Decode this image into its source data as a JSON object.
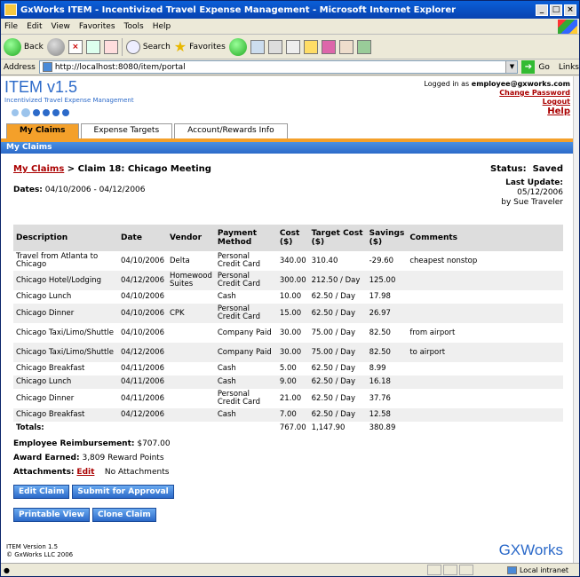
{
  "window": {
    "title": "GxWorks ITEM - Incentivized Travel Expense Management - Microsoft Internet Explorer"
  },
  "menu": [
    "File",
    "Edit",
    "View",
    "Favorites",
    "Tools",
    "Help"
  ],
  "toolbar": {
    "back": "Back",
    "search": "Search",
    "favorites": "Favorites"
  },
  "address": {
    "label": "Address",
    "url": "http://localhost:8080/item/portal",
    "go": "Go",
    "links": "Links"
  },
  "header": {
    "app_title": "ITEM v1.5",
    "app_subtitle": "Incentivized Travel Expense Management",
    "logged_in_prefix": "Logged in as",
    "user_email": "employee@gxworks.com",
    "change_password": "Change Password",
    "logout": "Logout",
    "help": "Help"
  },
  "tabs": [
    {
      "label": "My Claims",
      "active": true
    },
    {
      "label": "Expense Targets",
      "active": false
    },
    {
      "label": "Account/Rewards Info",
      "active": false
    }
  ],
  "section_title": "My Claims",
  "claim": {
    "breadcrumb_link": "My Claims",
    "breadcrumb_rest": "> Claim 18: Chicago Meeting",
    "status_label": "Status:",
    "status_value": "Saved",
    "dates_label": "Dates:",
    "dates_value": "04/10/2006 - 04/12/2006",
    "last_update_label": "Last Update:",
    "last_update_date": "05/12/2006",
    "last_update_by": "by Sue Traveler"
  },
  "table": {
    "headers": [
      "Description",
      "Date",
      "Vendor",
      "Payment Method",
      "Cost ($)",
      "Target Cost ($)",
      "Savings ($)",
      "Comments"
    ],
    "rows": [
      [
        "Travel from Atlanta to Chicago",
        "04/10/2006",
        "Delta",
        "Personal Credit Card",
        "340.00",
        "310.40",
        "-29.60",
        "cheapest nonstop"
      ],
      [
        "Chicago Hotel/Lodging",
        "04/12/2006",
        "Homewood Suites",
        "Personal Credit Card",
        "300.00",
        "212.50 / Day",
        "125.00",
        ""
      ],
      [
        "Chicago Lunch",
        "04/10/2006",
        "",
        "Cash",
        "10.00",
        "62.50 / Day",
        "17.98",
        ""
      ],
      [
        "Chicago Dinner",
        "04/10/2006",
        "CPK",
        "Personal Credit Card",
        "15.00",
        "62.50 / Day",
        "26.97",
        ""
      ],
      [
        "Chicago Taxi/Limo/Shuttle",
        "04/10/2006",
        "",
        "Company Paid",
        "30.00",
        "75.00 / Day",
        "82.50",
        "from airport"
      ],
      [
        "Chicago Taxi/Limo/Shuttle",
        "04/12/2006",
        "",
        "Company Paid",
        "30.00",
        "75.00 / Day",
        "82.50",
        "to airport"
      ],
      [
        "Chicago Breakfast",
        "04/11/2006",
        "",
        "Cash",
        "5.00",
        "62.50 / Day",
        "8.99",
        ""
      ],
      [
        "Chicago Lunch",
        "04/11/2006",
        "",
        "Cash",
        "9.00",
        "62.50 / Day",
        "16.18",
        ""
      ],
      [
        "Chicago Dinner",
        "04/11/2006",
        "",
        "Personal Credit Card",
        "21.00",
        "62.50 / Day",
        "37.76",
        ""
      ],
      [
        "Chicago Breakfast",
        "04/12/2006",
        "",
        "Cash",
        "7.00",
        "62.50 / Day",
        "12.58",
        ""
      ]
    ],
    "totals": {
      "label": "Totals:",
      "cost": "767.00",
      "target": "1,147.90",
      "savings": "380.89"
    }
  },
  "summary": {
    "reimb_label": "Employee Reimbursement:",
    "reimb_value": "$707.00",
    "award_label": "Award Earned:",
    "award_value": "3,809 Reward Points",
    "attach_label": "Attachments:",
    "attach_edit": "Edit",
    "attach_value": "No Attachments"
  },
  "buttons": {
    "edit": "Edit Claim",
    "submit": "Submit for Approval",
    "print": "Printable View",
    "clone": "Clone Claim"
  },
  "footer": {
    "version": "ITEM Version 1.5",
    "copyright": "© GxWorks LLC 2006",
    "logo": "GXWorks"
  },
  "statusbar": {
    "zone": "Local intranet"
  }
}
